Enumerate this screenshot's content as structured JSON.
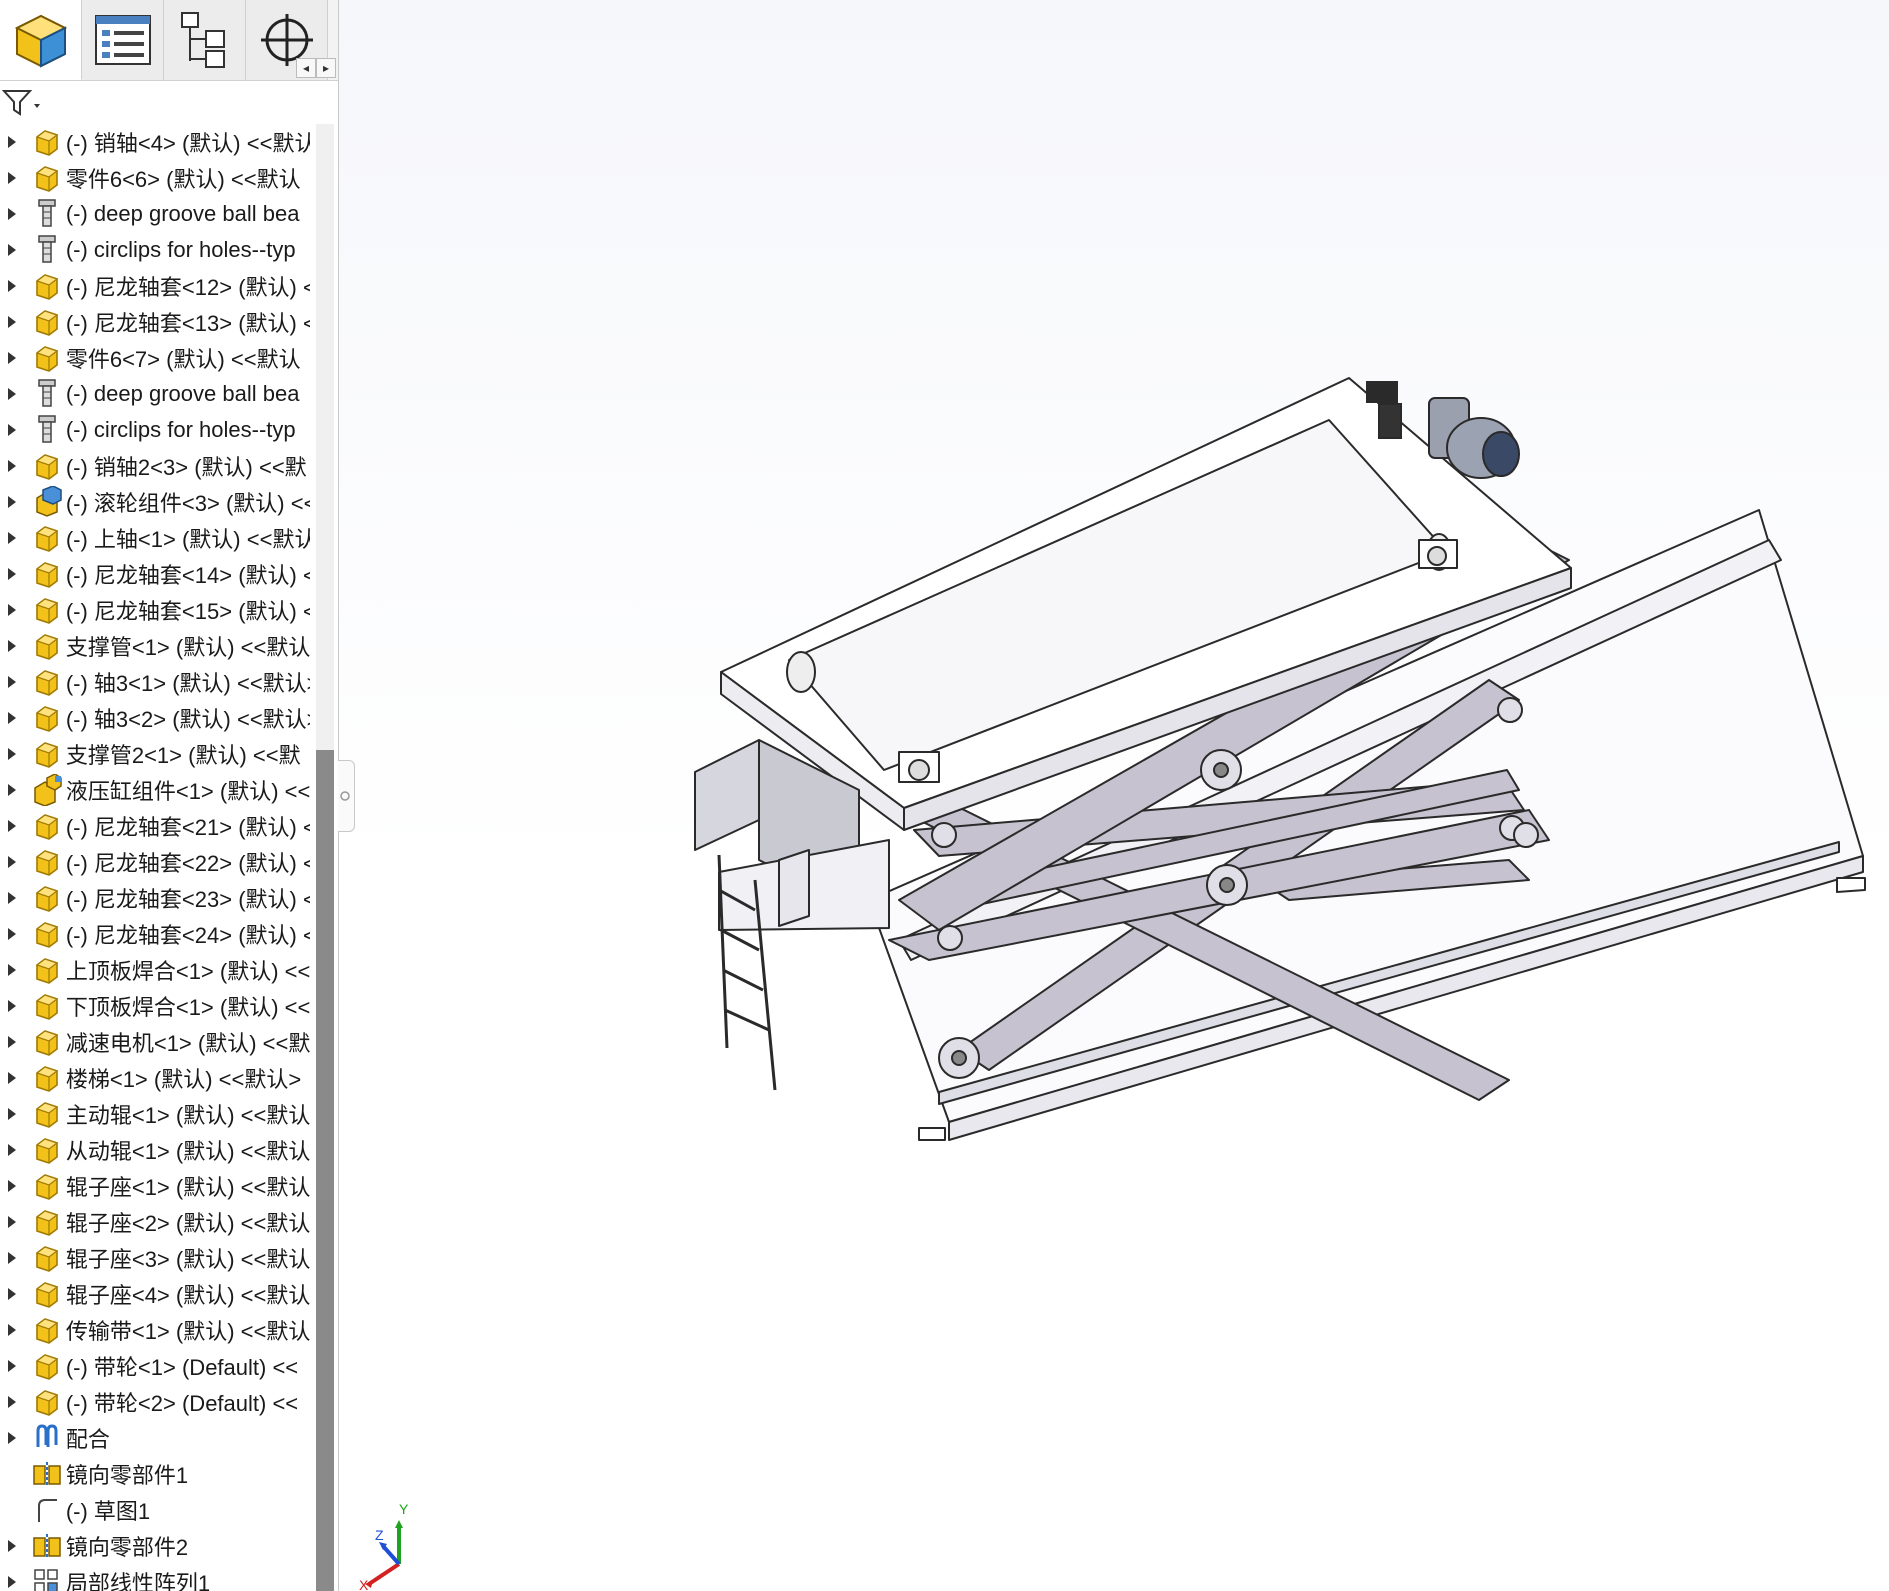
{
  "panel_tabs": [
    {
      "name": "FeatureManager",
      "icon": "part-cube-icon",
      "active": true
    },
    {
      "name": "PropertyManager",
      "icon": "property-list-icon",
      "active": false
    },
    {
      "name": "ConfigurationManager",
      "icon": "configuration-tree-icon",
      "active": false
    },
    {
      "name": "DimXpertManager",
      "icon": "crosshair-target-icon",
      "active": false
    }
  ],
  "tab_scroll": {
    "left": "◂",
    "right": "▸"
  },
  "filter": {
    "icon": "filter-funnel-icon"
  },
  "tree": {
    "items": [
      {
        "label": "(-) 销轴<4> (默认) <<默认",
        "icon": "part-icon",
        "expandable": true
      },
      {
        "label": "零件6<6> (默认) <<默认",
        "icon": "part-icon",
        "expandable": true
      },
      {
        "label": "(-) deep groove ball bea",
        "icon": "toolbox-part-icon",
        "expandable": true
      },
      {
        "label": "(-) circlips for holes--typ",
        "icon": "toolbox-part-icon",
        "expandable": true
      },
      {
        "label": "(-) 尼龙轴套<12> (默认) <",
        "icon": "part-icon",
        "expandable": true
      },
      {
        "label": "(-) 尼龙轴套<13> (默认) <",
        "icon": "part-icon",
        "expandable": true
      },
      {
        "label": "零件6<7> (默认) <<默认",
        "icon": "part-icon",
        "expandable": true
      },
      {
        "label": "(-) deep groove ball bea",
        "icon": "toolbox-part-icon",
        "expandable": true
      },
      {
        "label": "(-) circlips for holes--typ",
        "icon": "toolbox-part-icon",
        "expandable": true
      },
      {
        "label": "(-) 销轴2<3> (默认) <<默",
        "icon": "part-icon",
        "expandable": true
      },
      {
        "label": "(-) 滚轮组件<3> (默认) <<",
        "icon": "subassembly-icon",
        "expandable": true
      },
      {
        "label": "(-) 上轴<1> (默认) <<默认",
        "icon": "part-icon",
        "expandable": true
      },
      {
        "label": "(-) 尼龙轴套<14> (默认) <",
        "icon": "part-icon",
        "expandable": true
      },
      {
        "label": "(-) 尼龙轴套<15> (默认) <",
        "icon": "part-icon",
        "expandable": true
      },
      {
        "label": "支撑管<1> (默认) <<默认>",
        "icon": "part-icon",
        "expandable": true
      },
      {
        "label": "(-) 轴3<1> (默认) <<默认>",
        "icon": "part-icon",
        "expandable": true
      },
      {
        "label": "(-) 轴3<2> (默认) <<默认>",
        "icon": "part-icon",
        "expandable": true
      },
      {
        "label": "支撑管2<1> (默认) <<默",
        "icon": "part-icon",
        "expandable": true
      },
      {
        "label": "液压缸组件<1> (默认) <<",
        "icon": "assembly-icon",
        "expandable": true
      },
      {
        "label": "(-) 尼龙轴套<21> (默认) <",
        "icon": "part-icon",
        "expandable": true
      },
      {
        "label": "(-) 尼龙轴套<22> (默认) <",
        "icon": "part-icon",
        "expandable": true
      },
      {
        "label": "(-) 尼龙轴套<23> (默认) <",
        "icon": "part-icon",
        "expandable": true
      },
      {
        "label": "(-) 尼龙轴套<24> (默认) <",
        "icon": "part-icon",
        "expandable": true
      },
      {
        "label": "上顶板焊合<1> (默认) <<",
        "icon": "part-icon",
        "expandable": true
      },
      {
        "label": "下顶板焊合<1> (默认) <<",
        "icon": "part-icon",
        "expandable": true
      },
      {
        "label": "减速电机<1> (默认) <<默",
        "icon": "part-icon",
        "expandable": true
      },
      {
        "label": "楼梯<1> (默认) <<默认>",
        "icon": "part-icon",
        "expandable": true
      },
      {
        "label": "主动辊<1> (默认) <<默认",
        "icon": "part-icon",
        "expandable": true
      },
      {
        "label": "从动辊<1> (默认) <<默认",
        "icon": "part-icon",
        "expandable": true
      },
      {
        "label": "辊子座<1> (默认) <<默认",
        "icon": "part-icon",
        "expandable": true
      },
      {
        "label": "辊子座<2> (默认) <<默认",
        "icon": "part-icon",
        "expandable": true
      },
      {
        "label": "辊子座<3> (默认) <<默认",
        "icon": "part-icon",
        "expandable": true
      },
      {
        "label": "辊子座<4> (默认) <<默认",
        "icon": "part-icon",
        "expandable": true
      },
      {
        "label": "传输带<1> (默认) <<默认",
        "icon": "part-icon",
        "expandable": true
      },
      {
        "label": "(-) 带轮<1> (Default) <<",
        "icon": "part-icon",
        "expandable": true
      },
      {
        "label": "(-) 带轮<2> (Default) <<",
        "icon": "part-icon",
        "expandable": true
      },
      {
        "label": "配合",
        "icon": "mates-paperclip-icon",
        "expandable": true
      },
      {
        "label": "镜向零部件1",
        "icon": "mirror-component-icon",
        "expandable": false
      },
      {
        "label": "(-) 草图1",
        "icon": "sketch-icon",
        "expandable": false
      },
      {
        "label": "镜向零部件2",
        "icon": "mirror-component-icon",
        "expandable": true
      },
      {
        "label": "局部线性阵列1",
        "icon": "linear-pattern-icon",
        "expandable": true
      }
    ]
  },
  "triad": {
    "x": "X",
    "y": "Y",
    "z": "Z",
    "x_color": "#d42020",
    "y_color": "#1fa31f",
    "z_color": "#1f4fd4"
  },
  "colors": {
    "part_icon": "#f2c21b",
    "part_icon_stroke": "#a07a00",
    "model_fill": "#ffffff",
    "model_edge": "#2a2a2a",
    "scissor_fill": "#c6c2cf"
  }
}
